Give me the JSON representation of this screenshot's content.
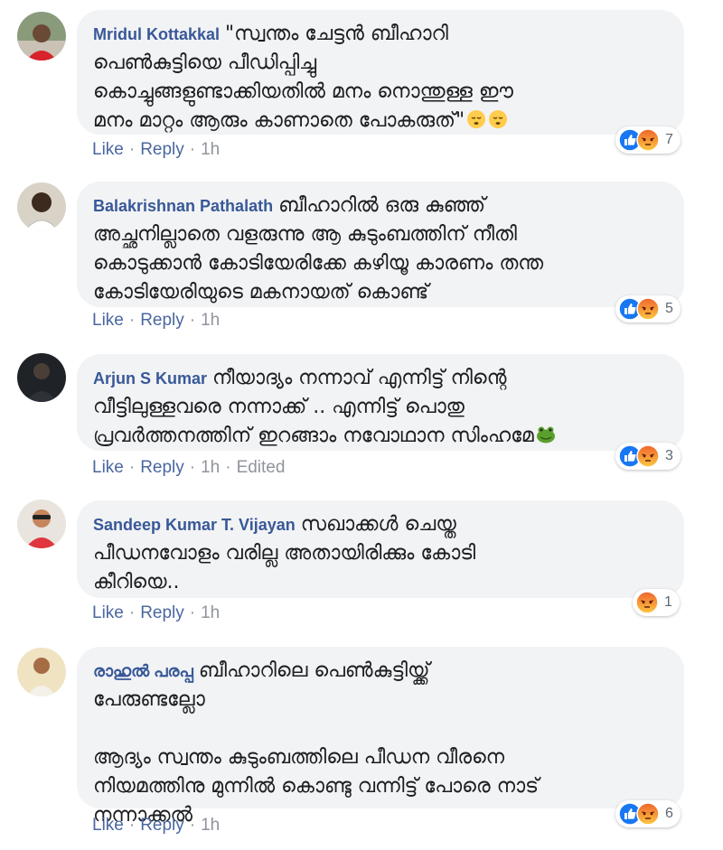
{
  "colors": {
    "author_link": "#385898",
    "bubble_bg": "#f2f3f5",
    "meta_gray": "#90949c",
    "like_blue": "#1877f2",
    "angry_orange": "#f0642d"
  },
  "comments": [
    {
      "author": "Mridul Kottakkal",
      "text": "\"സ്വന്തം ചേട്ടൻ ബീഹാറി\nപെൺകുട്ടിയെ പീഡിപ്പിച്ചു\nകൊച്ചുങ്ങളുണ്ടാക്കിയതിൽ മനം നൊന്തുള്ള ഈ\nമനം മാറ്റം ആരും കാണാതെ പോകരുത്\"",
      "emoji": [
        "sleepy-face-icon",
        "sleepy-face-icon"
      ],
      "actions": {
        "like": "Like",
        "reply": "Reply",
        "time": "1h"
      },
      "reactions": {
        "types": [
          "like",
          "angry"
        ],
        "count": "7"
      }
    },
    {
      "author": "Balakrishnan Pathalath",
      "text": "ബീഹാറിൽ ഒരു കുഞ്ഞ്\nഅച്ഛനില്ലാതെ വളരുന്നു ആ കുടുംബത്തിന് നീതി\nകൊടുക്കാൻ കോടിയേരിക്കേ കഴിയൂ കാരണം തന്ത\nകോടിയേരിയുടെ മകനായത് കൊണ്ട്",
      "actions": {
        "like": "Like",
        "reply": "Reply",
        "time": "1h"
      },
      "reactions": {
        "types": [
          "like",
          "angry"
        ],
        "count": "5"
      }
    },
    {
      "author": "Arjun S Kumar",
      "text": "നീയാദ്യം നന്നാവ് എന്നിട്ട് നിന്റെ\nവീട്ടിലുള്ളവരെ നന്നാക്ക് .. എന്നിട്ട് പൊതു\nപ്രവർത്തനത്തിന് ഇറങ്ങാം നവോഥാന സിംഹമേ",
      "emoji": [
        "frog-face-icon"
      ],
      "actions": {
        "like": "Like",
        "reply": "Reply",
        "time": "1h",
        "edited": "Edited"
      },
      "reactions": {
        "types": [
          "like",
          "angry"
        ],
        "count": "3"
      }
    },
    {
      "author": "Sandeep Kumar T. Vijayan",
      "text": "സഖാക്കൾ ചെയ്ത\nപീഡനവോളം വരില്ല അതായിരിക്കും കോടി\nകീറിയെ..",
      "actions": {
        "like": "Like",
        "reply": "Reply",
        "time": "1h"
      },
      "reactions": {
        "types": [
          "angry"
        ],
        "count": "1"
      }
    },
    {
      "author": "രാഹുൽ പരപ്പ",
      "text": "ബീഹാറിലെ പെൺകുട്ടിയ്ക്ക്\nപേരുണ്ടല്ലോ\n\nആദ്യം സ്വന്തം കുടുംബത്തിലെ പീഡന വീരനെ\nനിയമത്തിനു മുന്നിൽ കൊണ്ടു വന്നിട്ട് പോരെ നാട്\nനന്നാക്കൽ",
      "actions": {
        "like": "Like",
        "reply": "Reply",
        "time": "1h"
      },
      "reactions": {
        "types": [
          "like",
          "angry"
        ],
        "count": "6"
      }
    }
  ]
}
